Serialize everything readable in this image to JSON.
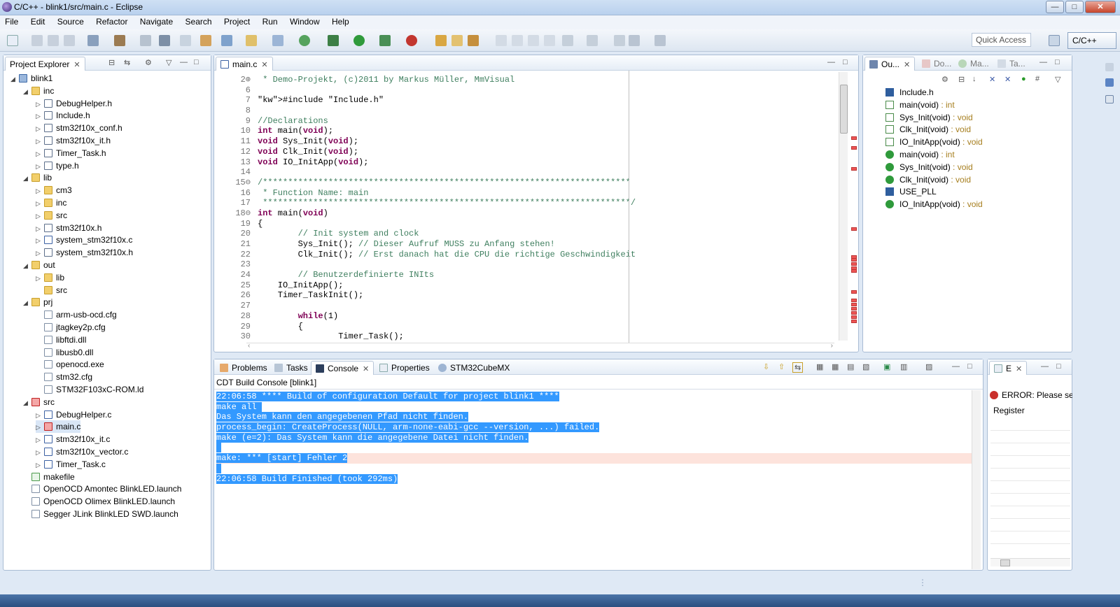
{
  "window": {
    "title": "C/C++ - blink1/src/main.c - Eclipse",
    "min_label": "—",
    "max_label": "□",
    "close_label": "✕"
  },
  "menu": [
    "File",
    "Edit",
    "Source",
    "Refactor",
    "Navigate",
    "Search",
    "Project",
    "Run",
    "Window",
    "Help"
  ],
  "toolbar": {
    "quick_access": "Quick Access",
    "perspective": "C/C++"
  },
  "project_explorer": {
    "tab_label": "Project Explorer",
    "rows": [
      {
        "label": "blink1",
        "depth": 0,
        "icon": "proj",
        "exp": "open"
      },
      {
        "label": "inc",
        "depth": 1,
        "icon": "folder",
        "exp": "open"
      },
      {
        "label": "DebugHelper.h",
        "depth": 2,
        "icon": "h",
        "exp": "closed"
      },
      {
        "label": "Include.h",
        "depth": 2,
        "icon": "h",
        "exp": "closed"
      },
      {
        "label": "stm32f10x_conf.h",
        "depth": 2,
        "icon": "h",
        "exp": "closed"
      },
      {
        "label": "stm32f10x_it.h",
        "depth": 2,
        "icon": "h",
        "exp": "closed"
      },
      {
        "label": "Timer_Task.h",
        "depth": 2,
        "icon": "h",
        "exp": "closed"
      },
      {
        "label": "type.h",
        "depth": 2,
        "icon": "h",
        "exp": "closed"
      },
      {
        "label": "lib",
        "depth": 1,
        "icon": "folder",
        "exp": "open"
      },
      {
        "label": "cm3",
        "depth": 2,
        "icon": "folder",
        "exp": "closed"
      },
      {
        "label": "inc",
        "depth": 2,
        "icon": "folder",
        "exp": "closed"
      },
      {
        "label": "src",
        "depth": 2,
        "icon": "folder",
        "exp": "closed"
      },
      {
        "label": "stm32f10x.h",
        "depth": 2,
        "icon": "h",
        "exp": "closed"
      },
      {
        "label": "system_stm32f10x.c",
        "depth": 2,
        "icon": "c",
        "exp": "closed"
      },
      {
        "label": "system_stm32f10x.h",
        "depth": 2,
        "icon": "h",
        "exp": "closed"
      },
      {
        "label": "out",
        "depth": 1,
        "icon": "folder",
        "exp": "open"
      },
      {
        "label": "lib",
        "depth": 2,
        "icon": "folder",
        "exp": "closed"
      },
      {
        "label": "src",
        "depth": 2,
        "icon": "folder",
        "exp": "none"
      },
      {
        "label": "prj",
        "depth": 1,
        "icon": "folder",
        "exp": "open"
      },
      {
        "label": "arm-usb-ocd.cfg",
        "depth": 2,
        "icon": "file",
        "exp": "none"
      },
      {
        "label": "jtagkey2p.cfg",
        "depth": 2,
        "icon": "file",
        "exp": "none"
      },
      {
        "label": "libftdi.dll",
        "depth": 2,
        "icon": "file",
        "exp": "none"
      },
      {
        "label": "libusb0.dll",
        "depth": 2,
        "icon": "file",
        "exp": "none"
      },
      {
        "label": "openocd.exe",
        "depth": 2,
        "icon": "file",
        "exp": "none"
      },
      {
        "label": "stm32.cfg",
        "depth": 2,
        "icon": "file",
        "exp": "none"
      },
      {
        "label": "STM32F103xC-ROM.ld",
        "depth": 2,
        "icon": "file",
        "exp": "none"
      },
      {
        "label": "src",
        "depth": 1,
        "icon": "err",
        "exp": "open"
      },
      {
        "label": "DebugHelper.c",
        "depth": 2,
        "icon": "c",
        "exp": "closed"
      },
      {
        "label": "main.c",
        "depth": 2,
        "icon": "err",
        "exp": "closed",
        "selected": true
      },
      {
        "label": "stm32f10x_it.c",
        "depth": 2,
        "icon": "c",
        "exp": "closed"
      },
      {
        "label": "stm32f10x_vector.c",
        "depth": 2,
        "icon": "c",
        "exp": "closed"
      },
      {
        "label": "Timer_Task.c",
        "depth": 2,
        "icon": "c",
        "exp": "closed"
      },
      {
        "label": "makefile",
        "depth": 1,
        "icon": "launch",
        "exp": "none"
      },
      {
        "label": "OpenOCD Amontec BlinkLED.launch",
        "depth": 1,
        "icon": "file",
        "exp": "none"
      },
      {
        "label": "OpenOCD Olimex BlinkLED.launch",
        "depth": 1,
        "icon": "file",
        "exp": "none"
      },
      {
        "label": "Segger JLink BlinkLED SWD.launch",
        "depth": 1,
        "icon": "file",
        "exp": "none"
      }
    ]
  },
  "editor": {
    "tab_label": "main.c",
    "lines": [
      {
        "n": "2⊕",
        "t": " * Demo-Projekt, (c)2011 by Markus Müller, MmVisual",
        "k": "cm"
      },
      {
        "n": "6",
        "t": "",
        "k": ""
      },
      {
        "n": "7",
        "t": "#include \"Include.h\"",
        "k": "inc"
      },
      {
        "n": "8",
        "t": "",
        "k": ""
      },
      {
        "n": "9",
        "t": "//Declarations",
        "k": "cm"
      },
      {
        "n": "10",
        "t": "int main(void);",
        "k": "decl"
      },
      {
        "n": "11",
        "t": "void Sys_Init(void);",
        "k": "decl"
      },
      {
        "n": "12",
        "t": "void Clk_Init(void);",
        "k": "decl"
      },
      {
        "n": "13",
        "t": "void IO_InitApp(void);",
        "k": "decl"
      },
      {
        "n": "14",
        "t": "",
        "k": ""
      },
      {
        "n": "15⊖",
        "t": "/*************************************************************************",
        "k": "cm"
      },
      {
        "n": "16",
        "t": " * Function Name: main",
        "k": "cm"
      },
      {
        "n": "17",
        "t": " *************************************************************************/",
        "k": "cm"
      },
      {
        "n": "18⊖",
        "t": "int main(void)",
        "k": "decl"
      },
      {
        "n": "19",
        "t": "{",
        "k": ""
      },
      {
        "n": "20",
        "t": "        // Init system and clock",
        "k": "cm"
      },
      {
        "n": "21",
        "t": "        Sys_Init(); // Dieser Aufruf MUSS zu Anfang stehen!",
        "k": "mix"
      },
      {
        "n": "22",
        "t": "        Clk_Init(); // Erst danach hat die CPU die richtige Geschwindigkeit",
        "k": "mix"
      },
      {
        "n": "23",
        "t": "",
        "k": ""
      },
      {
        "n": "24",
        "t": "        // Benutzerdefinierte INIts",
        "k": "cm"
      },
      {
        "n": "25",
        "t": "    IO_InitApp();",
        "k": ""
      },
      {
        "n": "26",
        "t": "    Timer_TaskInit();",
        "k": ""
      },
      {
        "n": "27",
        "t": "",
        "k": ""
      },
      {
        "n": "28",
        "t": "        while(1)",
        "k": "while"
      },
      {
        "n": "29",
        "t": "        {",
        "k": ""
      },
      {
        "n": "30",
        "t": "                Timer_Task();",
        "k": ""
      }
    ]
  },
  "outline": {
    "tabs": [
      "Ou...",
      "Do...",
      "Ma...",
      "Ta..."
    ],
    "rows": [
      {
        "name": "Include.h",
        "ret": "",
        "icon": "include"
      },
      {
        "name": "main(void)",
        "ret": " : int",
        "icon": "decl"
      },
      {
        "name": "Sys_Init(void)",
        "ret": " : void",
        "icon": "decl"
      },
      {
        "name": "Clk_Init(void)",
        "ret": " : void",
        "icon": "decl"
      },
      {
        "name": "IO_InitApp(void)",
        "ret": " : void",
        "icon": "decl"
      },
      {
        "name": "main(void)",
        "ret": " : int",
        "icon": "func"
      },
      {
        "name": "Sys_Init(void)",
        "ret": " : void",
        "icon": "func"
      },
      {
        "name": "Clk_Init(void)",
        "ret": " : void",
        "icon": "func"
      },
      {
        "name": "USE_PLL",
        "ret": "",
        "icon": "macro"
      },
      {
        "name": "IO_InitApp(void)",
        "ret": " : void",
        "icon": "func"
      }
    ]
  },
  "console": {
    "tabs": [
      "Problems",
      "Tasks",
      "Console",
      "Properties",
      "STM32CubeMX"
    ],
    "header": "CDT Build Console [blink1]",
    "lines": [
      {
        "t": "22:06:58 **** Build of configuration Default for project blink1 ****",
        "err": false
      },
      {
        "t": "make all ",
        "err": false
      },
      {
        "t": "Das System kann den angegebenen Pfad nicht finden.",
        "err": false
      },
      {
        "t": "process_begin: CreateProcess(NULL, arm-none-eabi-gcc --version, ...) failed.",
        "err": false
      },
      {
        "t": "make (e=2): Das System kann die angegebene Datei nicht finden.",
        "err": false
      },
      {
        "t": "",
        "err": false
      },
      {
        "t": "make: *** [start] Fehler 2",
        "err": true
      },
      {
        "t": "",
        "err": false
      },
      {
        "t": "22:06:58 Build Finished (took 292ms)",
        "err": false
      }
    ]
  },
  "errorlog": {
    "tab_label": "E",
    "message": "ERROR: Please sele",
    "column": "Register"
  }
}
